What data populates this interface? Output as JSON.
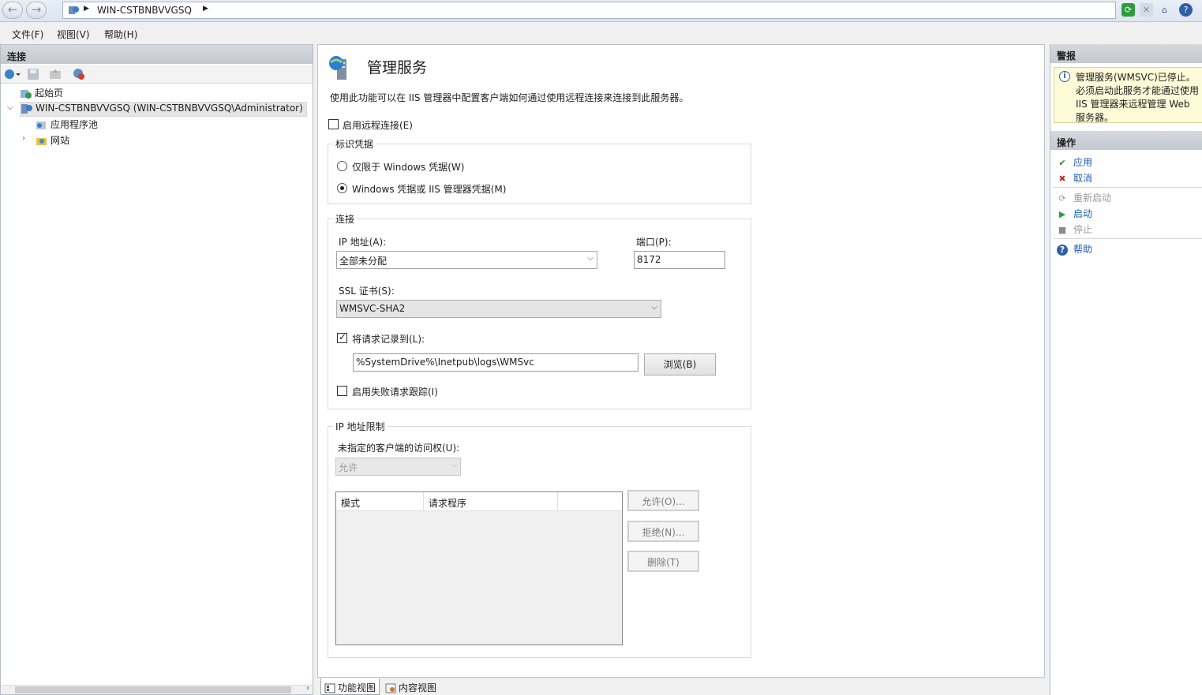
{
  "window": {
    "breadcrumb": "WIN-CSTBNBVVGSQ",
    "back_glyph": "←",
    "forward_glyph": "→"
  },
  "menu": {
    "file": "文件(F)",
    "view": "视图(V)",
    "help": "帮助(H)"
  },
  "connections": {
    "title": "连接",
    "tree": [
      {
        "label": "起始页",
        "icon": "start-page-icon"
      },
      {
        "label": "WIN-CSTBNBVVGSQ (WIN-CSTBNBVVGSQ\\Administrator)",
        "icon": "server-icon",
        "expanded": true,
        "selected": true
      },
      {
        "label": "应用程序池",
        "icon": "app-pool-icon"
      },
      {
        "label": "网站",
        "icon": "sites-icon",
        "collapsed": true
      }
    ]
  },
  "page": {
    "title": "管理服务",
    "description": "使用此功能可以在 IIS 管理器中配置客户端如何通过使用远程连接来连接到此服务器。",
    "enable_remote": {
      "label": "启用远程连接(E)",
      "checked": false
    },
    "identity": {
      "title": "标识凭据",
      "option_windows_only": "仅限于 Windows 凭据(W)",
      "option_windows_or_iis": "Windows 凭据或 IIS 管理器凭据(M)",
      "selected": "windows_or_iis"
    },
    "connection": {
      "title": "连接",
      "ip_label": "IP 地址(A):",
      "ip_value": "全部未分配",
      "port_label": "端口(P):",
      "port_value": "8172",
      "ssl_label": "SSL 证书(S):",
      "ssl_value": "WMSVC-SHA2",
      "log_label": "将请求记录到(L):",
      "log_checked": true,
      "log_path": "%SystemDrive%\\Inetpub\\logs\\WMSvc",
      "browse_label": "浏览(B)",
      "failed_trace_label": "启用失败请求跟踪(I)",
      "failed_trace_checked": false
    },
    "ip_restrictions": {
      "title": "IP 地址限制",
      "access_label": "未指定的客户端的访问权(U):",
      "access_value": "允许",
      "columns": [
        "模式",
        "请求程序",
        ""
      ],
      "allow_button": "允许(O)...",
      "deny_button": "拒绝(N)...",
      "remove_button": "删除(T)"
    }
  },
  "tabs": {
    "features": "功能视图",
    "content": "内容视图"
  },
  "alerts": {
    "title": "警报",
    "message": "管理服务(WMSVC)已停止。必须启动此服务才能通过使用 IIS 管理器来远程管理 Web 服务器。"
  },
  "actions": {
    "title": "操作",
    "apply": "应用",
    "cancel": "取消",
    "restart": "重新启动",
    "start": "启动",
    "stop": "停止",
    "help": "帮助"
  },
  "colors": {
    "link": "#1b5cb3",
    "disabled": "#9b9b9b",
    "panel_header": "#c4c9cf",
    "alert_bg": "#fdfbd8"
  }
}
